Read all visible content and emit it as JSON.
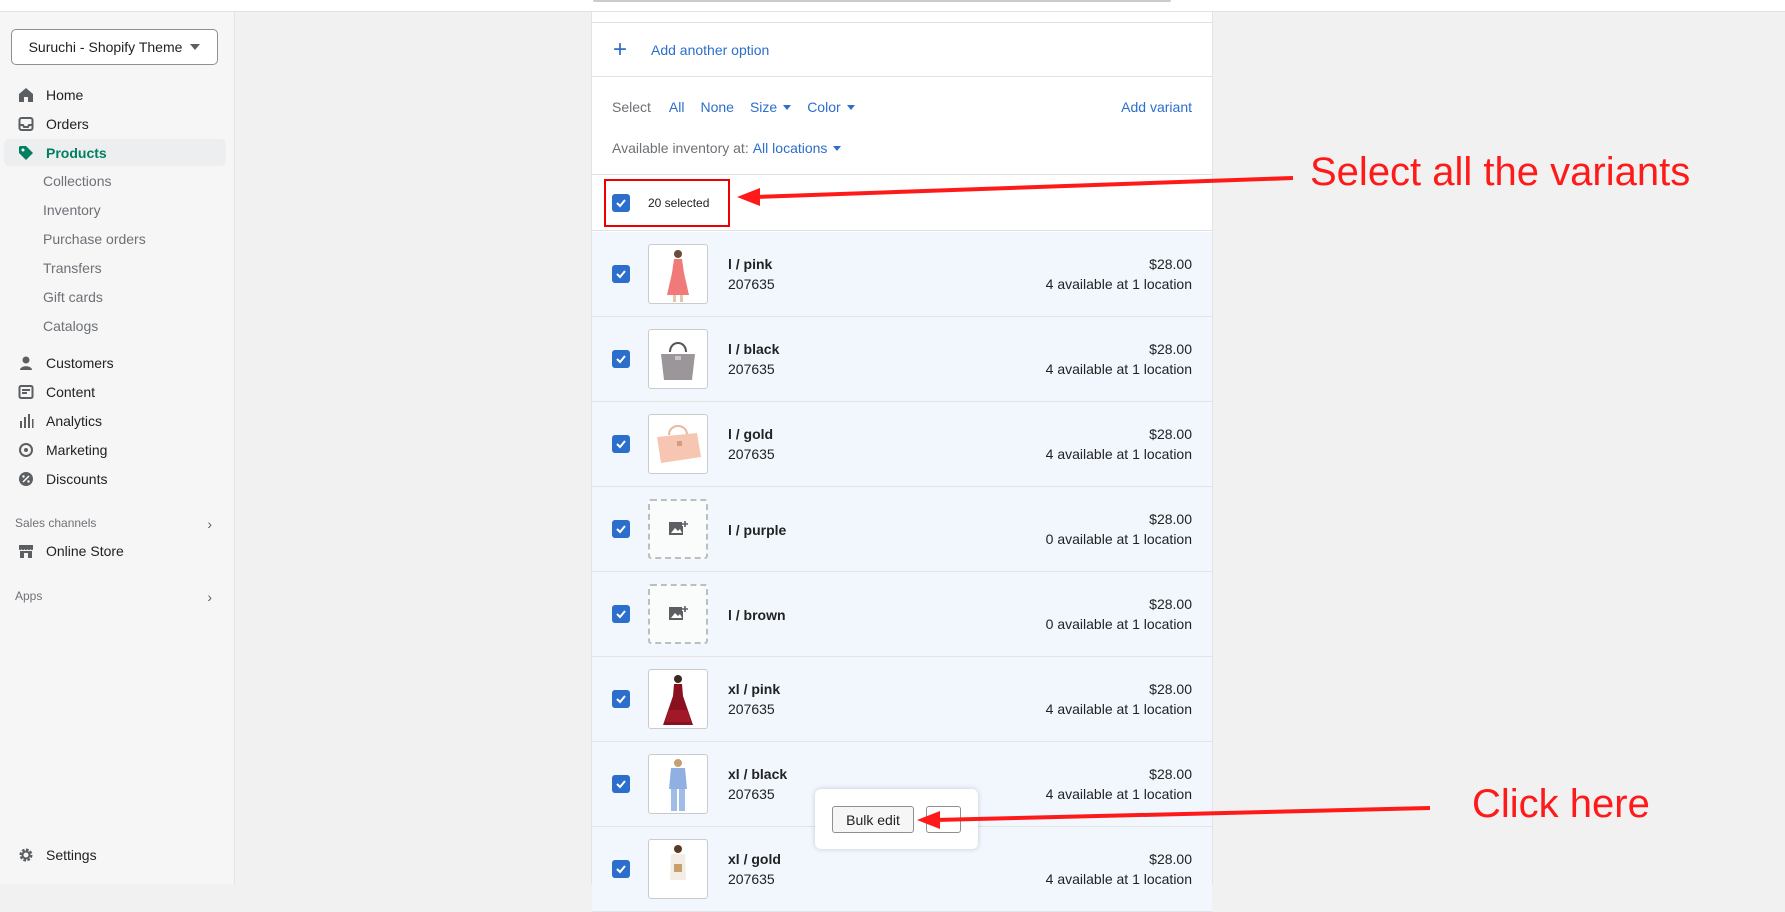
{
  "store": {
    "name": "Suruchi - Shopify Theme"
  },
  "nav": {
    "items": [
      {
        "label": "Home",
        "icon": "home-icon"
      },
      {
        "label": "Orders",
        "icon": "inbox-icon"
      },
      {
        "label": "Products",
        "icon": "tag-icon",
        "active": true
      },
      {
        "label": "Customers",
        "icon": "person-icon"
      },
      {
        "label": "Content",
        "icon": "content-icon"
      },
      {
        "label": "Analytics",
        "icon": "bar-chart-icon"
      },
      {
        "label": "Marketing",
        "icon": "target-icon"
      },
      {
        "label": "Discounts",
        "icon": "discount-icon"
      },
      {
        "label": "Online Store",
        "icon": "store-icon"
      },
      {
        "label": "Settings",
        "icon": "gear-icon"
      }
    ],
    "sub": [
      "Collections",
      "Inventory",
      "Purchase orders",
      "Transfers",
      "Gift cards",
      "Catalogs"
    ],
    "sales_channels": "Sales channels",
    "apps": "Apps"
  },
  "variants_panel": {
    "add_option": "Add another option",
    "select_label": "Select",
    "select_all": "All",
    "select_none": "None",
    "size": "Size",
    "color": "Color",
    "add_variant": "Add variant",
    "inventory_label": "Available inventory at:",
    "inventory_location": "All locations",
    "selected_count": "20 selected"
  },
  "variants": [
    {
      "name": "l / pink",
      "sku": "207635",
      "price": "$28.00",
      "availability": "4 available at 1 location",
      "image": "pink-dress"
    },
    {
      "name": "l / black",
      "sku": "207635",
      "price": "$28.00",
      "availability": "4 available at 1 location",
      "image": "grey-bag"
    },
    {
      "name": "l / gold",
      "sku": "207635",
      "price": "$28.00",
      "availability": "4 available at 1 location",
      "image": "peach-bag"
    },
    {
      "name": "l / purple",
      "sku": "",
      "price": "$28.00",
      "availability": "0 available at 1 location",
      "image": ""
    },
    {
      "name": "l / brown",
      "sku": "",
      "price": "$28.00",
      "availability": "0 available at 1 location",
      "image": ""
    },
    {
      "name": "xl / pink",
      "sku": "207635",
      "price": "$28.00",
      "availability": "4 available at 1 location",
      "image": "red-dress"
    },
    {
      "name": "xl / black",
      "sku": "207635",
      "price": "$28.00",
      "availability": "4 available at 1 location",
      "image": "blue-shirt"
    },
    {
      "name": "xl / gold",
      "sku": "207635",
      "price": "$28.00",
      "availability": "4 available at 1 location",
      "image": "white-top"
    }
  ],
  "popover": {
    "bulk_edit": "Bulk edit"
  },
  "annotations": {
    "select_all": "Select all the variants",
    "click_here": "Click here",
    "color": "#ff1a1a"
  },
  "colors": {
    "accent": "#2c6ecb",
    "active_nav": "#008060",
    "selected_row": "#f2f7fe"
  }
}
